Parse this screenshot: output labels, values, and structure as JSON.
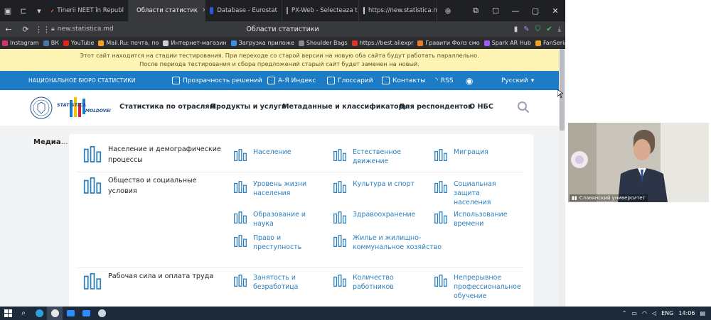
{
  "browser": {
    "tabs": [
      {
        "label": "Tinerii NEET în Republ",
        "active": false,
        "icon_color": "#e05a2a"
      },
      {
        "label": "Области статистик",
        "active": true,
        "icon_color": "#e05a2a"
      },
      {
        "label": "Database - Eurostat",
        "active": false,
        "icon_color": "#2a5bd7"
      },
      {
        "label": "PX-Web - Selecteaza t",
        "active": false,
        "icon_color": "#ffffff"
      },
      {
        "label": "https://new.statistica.m",
        "active": false,
        "icon_color": "#cccccc"
      }
    ],
    "url": "new.statistica.md",
    "page_title": "Области статистики",
    "bookmarks": [
      {
        "label": "Instagram",
        "color": "#d6336c"
      },
      {
        "label": "ВК",
        "color": "#4a76a8"
      },
      {
        "label": "YouTube",
        "color": "#e62117"
      },
      {
        "label": "Mail.Ru: почта, по",
        "color": "#f7a31c"
      },
      {
        "label": "Интернет-магазин",
        "color": "#cfcfcf"
      },
      {
        "label": "Загрузка приложе",
        "color": "#3a8ee6"
      },
      {
        "label": "Shoulder Bags",
        "color": "#888888"
      },
      {
        "label": "https://best.aliexpr",
        "color": "#e43225"
      },
      {
        "label": "Гравити Фолз смо",
        "color": "#ee7d22"
      },
      {
        "label": "Spark AR Hub",
        "color": "#a259ff"
      },
      {
        "label": "FanSerials",
        "color": "#f2a21e"
      }
    ],
    "more_bookmarks": "»"
  },
  "notice": {
    "line1": "Этот сайт находится на стадии тестирования. При переходе со старой версии на новую оба сайта будут работать параллельно.",
    "line2": "После периода тестирования и сбора предложений старый сайт будет заменен на новый."
  },
  "topbar": {
    "org": "НАЦИОНАЛЬНОЕ БЮРО СТАТИСТИКИ",
    "transparency": "Прозрачность решений",
    "az": "А-Я Индекс",
    "glossary": "Глоссарий",
    "contacts": "Контакты",
    "rss": "RSS",
    "language": "Русский"
  },
  "logo": {
    "line1": "STATISTICA",
    "line2": "MOLDOVEI"
  },
  "nav": {
    "item1": "Статистика по отраслям",
    "item2": "Продукты и услуги",
    "item3": "Метаданные и классификаторы",
    "item4": "Для респондентов",
    "item5": "О НБС"
  },
  "media": {
    "label": "Медиа",
    "dots": "..."
  },
  "categories": [
    {
      "title_l1": "Население и демографические",
      "title_l2": "процессы"
    },
    {
      "title_l1": "Общество и социальные",
      "title_l2": "условия"
    },
    {
      "title_l1": "Рабочая сила и оплата труда",
      "title_l2": ""
    }
  ],
  "subs": {
    "population": [
      "Население",
      ""
    ],
    "natural": [
      "Естественное",
      "движение"
    ],
    "migration": [
      "Миграция",
      ""
    ],
    "living": [
      "Уровень жизни",
      "населения"
    ],
    "culture": [
      "Культура и спорт",
      ""
    ],
    "social": [
      "Социальная",
      "защита",
      "населения"
    ],
    "education": [
      "Образование и",
      "наука"
    ],
    "health": [
      "Здравоохранение",
      ""
    ],
    "time": [
      "Использование",
      "времени"
    ],
    "law": [
      "Право и",
      "преступность"
    ],
    "housing": [
      "Жилье и жилищно-",
      "коммунальное хозяйство"
    ],
    "employment": [
      "Занятость и",
      "безработица"
    ],
    "workers": [
      "Количество",
      "работников"
    ],
    "training": [
      "Непрерывное",
      "профессиональное",
      "обучение"
    ]
  },
  "video": {
    "participant": "Славянский университет"
  },
  "taskbar": {
    "lang": "ENG",
    "time": "14:06"
  }
}
